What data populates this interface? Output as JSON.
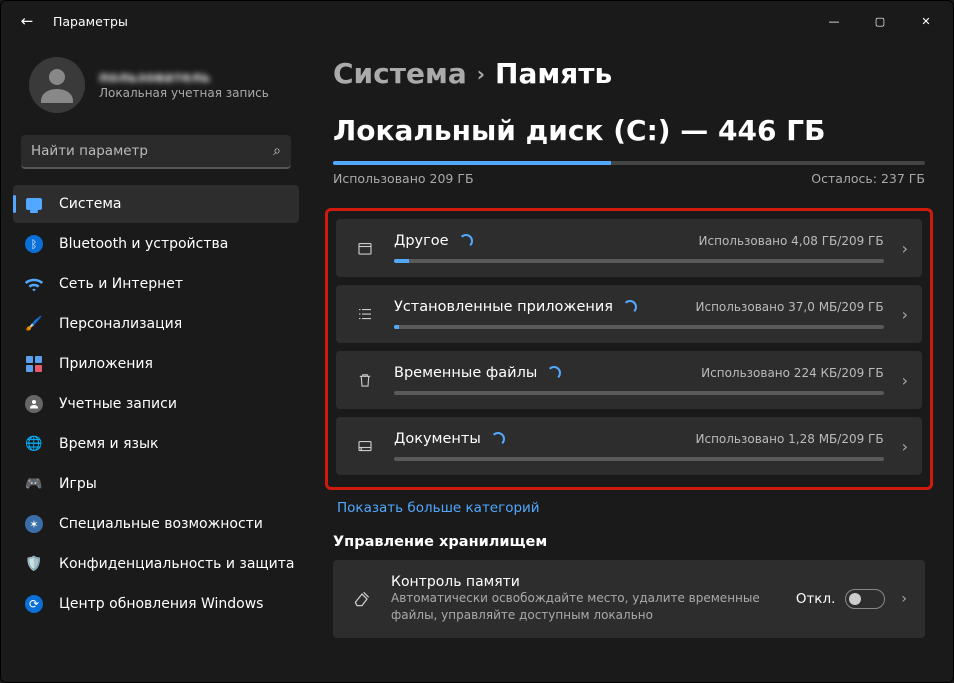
{
  "titlebar": {
    "title": "Параметры"
  },
  "user": {
    "name": "пользователь",
    "subtitle": "Локальная учетная запись"
  },
  "search": {
    "placeholder": "Найти параметр"
  },
  "nav": {
    "system": "Система",
    "bluetooth": "Bluetooth и устройства",
    "network": "Сеть и Интернет",
    "personalization": "Персонализация",
    "apps": "Приложения",
    "accounts": "Учетные записи",
    "time_lang": "Время и язык",
    "gaming": "Игры",
    "accessibility": "Специальные возможности",
    "privacy": "Конфиденциальность и защита",
    "update": "Центр обновления Windows"
  },
  "breadcrumb": {
    "parent": "Система",
    "current": "Память"
  },
  "disk": {
    "title": "Локальный диск (C:) — 446 ГБ",
    "used_label": "Использовано 209 ГБ",
    "remaining_label": "Осталось: 237 ГБ"
  },
  "categories": [
    {
      "name": "Другое",
      "usage": "Использовано 4,08 ГБ/209 ГБ",
      "fill_pct": 3
    },
    {
      "name": "Установленные приложения",
      "usage": "Использовано 37,0 МБ/209 ГБ",
      "fill_pct": 1
    },
    {
      "name": "Временные файлы",
      "usage": "Использовано 224 КБ/209 ГБ",
      "fill_pct": 0
    },
    {
      "name": "Документы",
      "usage": "Использовано 1,28 МБ/209 ГБ",
      "fill_pct": 0
    }
  ],
  "show_more": "Показать больше категорий",
  "storage_mgmt": {
    "section_title": "Управление хранилищем",
    "title": "Контроль памяти",
    "subtitle": "Автоматически освобождайте место, удалите временные файлы, управляйте доступным локально",
    "toggle_state": "Откл."
  }
}
